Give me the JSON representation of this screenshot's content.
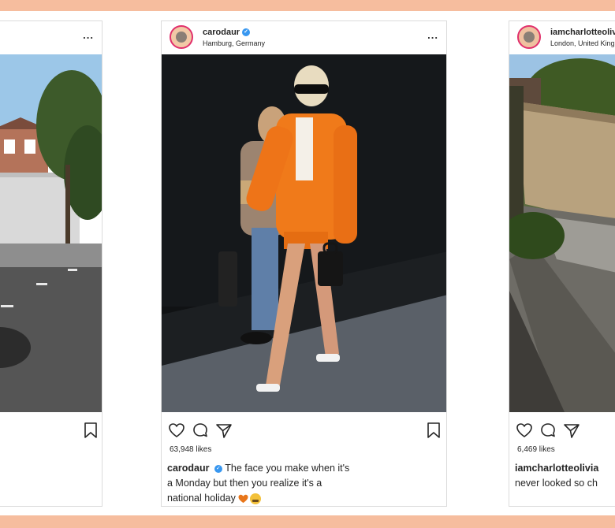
{
  "colors": {
    "frame": "#f6bd9e",
    "verified": "#3897f0"
  },
  "posts": [
    {
      "username": "",
      "location": "",
      "more_label": "...",
      "likes": "",
      "caption_user": "",
      "caption_text": ""
    },
    {
      "username": "carodaur",
      "location": "Hamburg, Germany",
      "more_label": "...",
      "likes": "63,948 likes",
      "caption_user": "carodaur",
      "caption_text": "The face you make when it's a Monday but then you realize it's a national holiday"
    },
    {
      "username": "iamcharlotteolivia",
      "location": "London, United Kingdom",
      "more_label": "...",
      "likes": "6,469 likes",
      "caption_user": "iamcharlotteolivia",
      "caption_text": "never looked so ch"
    }
  ],
  "icons": {
    "more": "more-options-icon",
    "like": "heart-icon",
    "comment": "comment-icon",
    "share": "share-icon",
    "save": "bookmark-icon",
    "verified": "verified-badge-icon"
  }
}
